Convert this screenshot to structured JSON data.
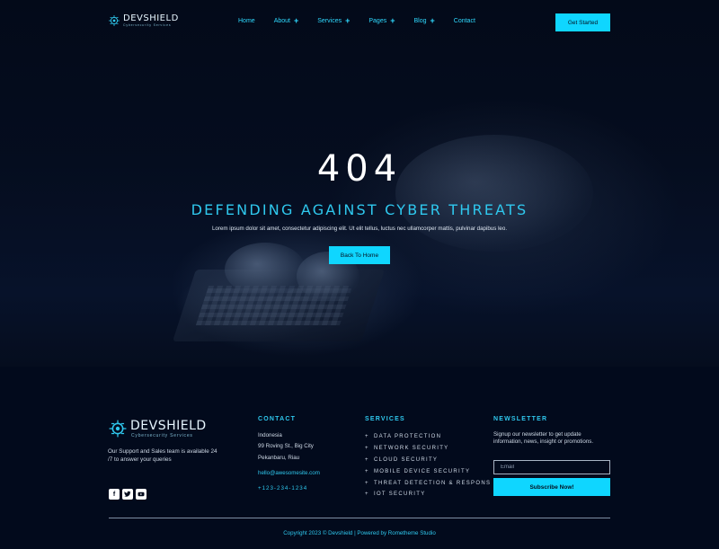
{
  "brand": {
    "name": "DEVSHIELD",
    "tagline": "Cybersecurity Services",
    "accent_color": "#0fd6ff",
    "background_color": "#02081a"
  },
  "nav": {
    "items": [
      {
        "label": "Home",
        "has_submenu": false
      },
      {
        "label": "About",
        "has_submenu": true
      },
      {
        "label": "Services",
        "has_submenu": true
      },
      {
        "label": "Pages",
        "has_submenu": true
      },
      {
        "label": "Blog",
        "has_submenu": true
      },
      {
        "label": "Contact",
        "has_submenu": false
      }
    ],
    "submenu_icon": "+",
    "cta_label": "Get Started"
  },
  "hero": {
    "code": "404",
    "title": "DEFENDING AGAINST CYBER THREATS",
    "text": "Lorem ipsum dolor sit amet, consectetur adipiscing elit. Ut elit tellus, luctus nec ullamcorper mattis, pulvinar dapibus leo.",
    "button_label": "Back To Home"
  },
  "footer": {
    "about": "Our Support and Sales team is available 24 /7 to answer your queries",
    "socials": [
      "facebook-icon",
      "twitter-icon",
      "youtube-icon"
    ],
    "contact": {
      "heading": "CONTACT",
      "country": "Indonesia",
      "street": "99 Roving St., Big City",
      "city": "Pekanbaru, Riau",
      "email": "hello@awesomesite.com",
      "phone": "+123-234-1234"
    },
    "services": {
      "heading": "SERVICES",
      "bullet": "+",
      "items": [
        "DATA PROTECTION",
        "NETWORK SECURITY",
        "CLOUD SECURITY",
        "MOBILE DEVICE SECURITY",
        "THREAT DETECTION & RESPONS",
        "IOT SECURITY"
      ]
    },
    "newsletter": {
      "heading": "NEWSLETTER",
      "text": "Signup our newsletter to get update information, news, insight or promotions.",
      "email_placeholder": "Email",
      "email_value": "",
      "button_label": "Subscribe Now!"
    },
    "copyright": "Copyright 2023 © Devshield | Powered by Rometheme Studio"
  }
}
